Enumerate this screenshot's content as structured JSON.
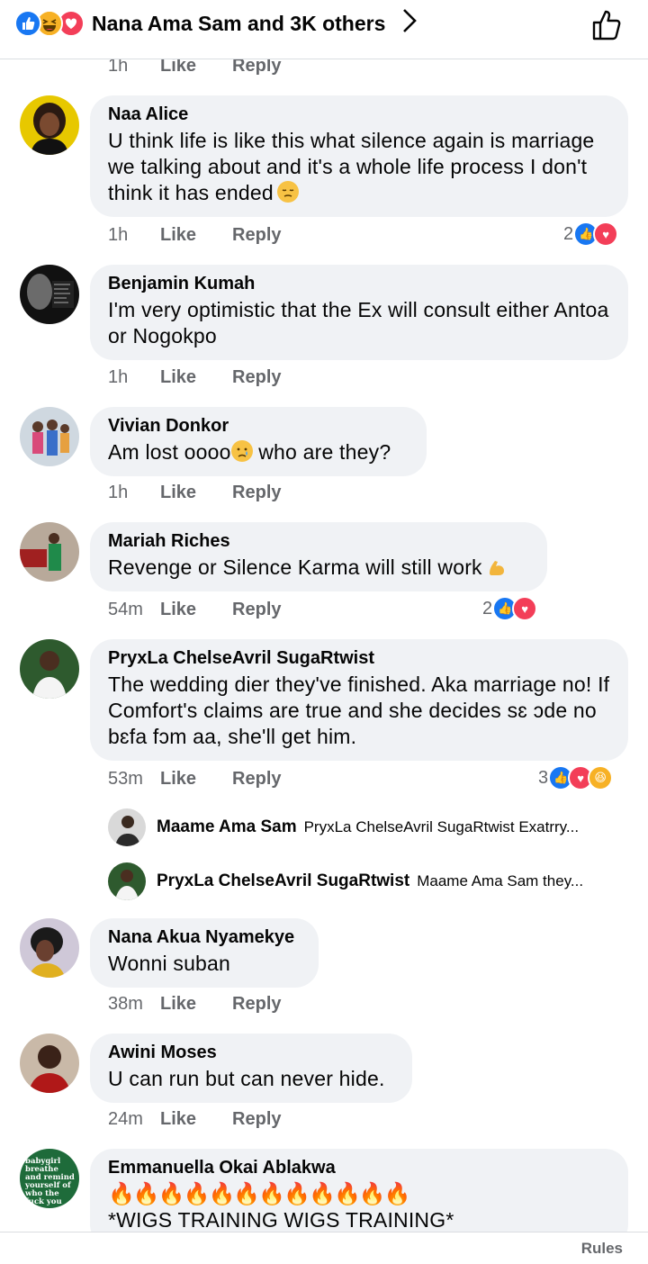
{
  "header": {
    "reactions_summary": "Nana Ama Sam and 3K others",
    "reaction_icons": [
      "like-icon",
      "haha-icon",
      "love-icon"
    ]
  },
  "top_meta": {
    "time": "1h",
    "like": "Like",
    "reply": "Reply"
  },
  "comments": [
    {
      "name": "Naa Alice",
      "text": "U think life is like this what silence again is marriage we talking about and it's a whole life process I don't think it has ended",
      "emoji": "pensive-face",
      "time": "1h",
      "like": "Like",
      "reply": "Reply",
      "reaction_count": "2"
    },
    {
      "name": "Benjamin Kumah",
      "text": "I'm very optimistic that the Ex will consult either Antoa or Nogokpo",
      "time": "1h",
      "like": "Like",
      "reply": "Reply"
    },
    {
      "name": "Vivian Donkor",
      "text_a": "Am lost oooo",
      "text_b": " who are they?",
      "emoji": "crying-face",
      "time": "1h",
      "like": "Like",
      "reply": "Reply"
    },
    {
      "name": "Mariah Riches",
      "text": "Revenge or Silence Karma will still work",
      "emoji": "flexed-biceps",
      "time": "54m",
      "like": "Like",
      "reply": "Reply",
      "reaction_count": "2"
    },
    {
      "name": "PryxLa ChelseAvril SugaRtwist",
      "text": "The wedding dier they've finished. Aka marriage no! If Comfort's claims are true and she decides sɛ ɔde no bɛfa fɔm aa, she'll get him.",
      "time": "53m",
      "like": "Like",
      "reply": "Reply",
      "reaction_count": "3",
      "replies": [
        {
          "name": "Maame Ama Sam",
          "snippet": "PryxLa ChelseAvril SugaRtwist Exatrry..."
        },
        {
          "name": "PryxLa ChelseAvril SugaRtwist",
          "snippet": "Maame Ama Sam they..."
        }
      ]
    },
    {
      "name": "Nana Akua Nyamekye",
      "text": "Wonni suban",
      "time": "38m",
      "like": "Like",
      "reply": "Reply"
    },
    {
      "name": "Awini Moses",
      "text": "U can run but can never hide.",
      "time": "24m",
      "like": "Like",
      "reply": "Reply"
    },
    {
      "name": "Emmanuella Okai Ablakwa",
      "fires": "🔥🔥🔥🔥🔥🔥🔥🔥🔥🔥🔥🔥",
      "text": "*WIGS TRAINING WIGS TRAINING*",
      "avatar_text": "babygirl breathe and remind yourself of who the fuck you are."
    }
  ],
  "footer": {
    "rules": "Rules"
  },
  "colors": {
    "like": "#1877f2",
    "love": "#f33e58",
    "haha": "#f7b125",
    "bubble": "#f0f2f5",
    "meta": "#65676b"
  }
}
